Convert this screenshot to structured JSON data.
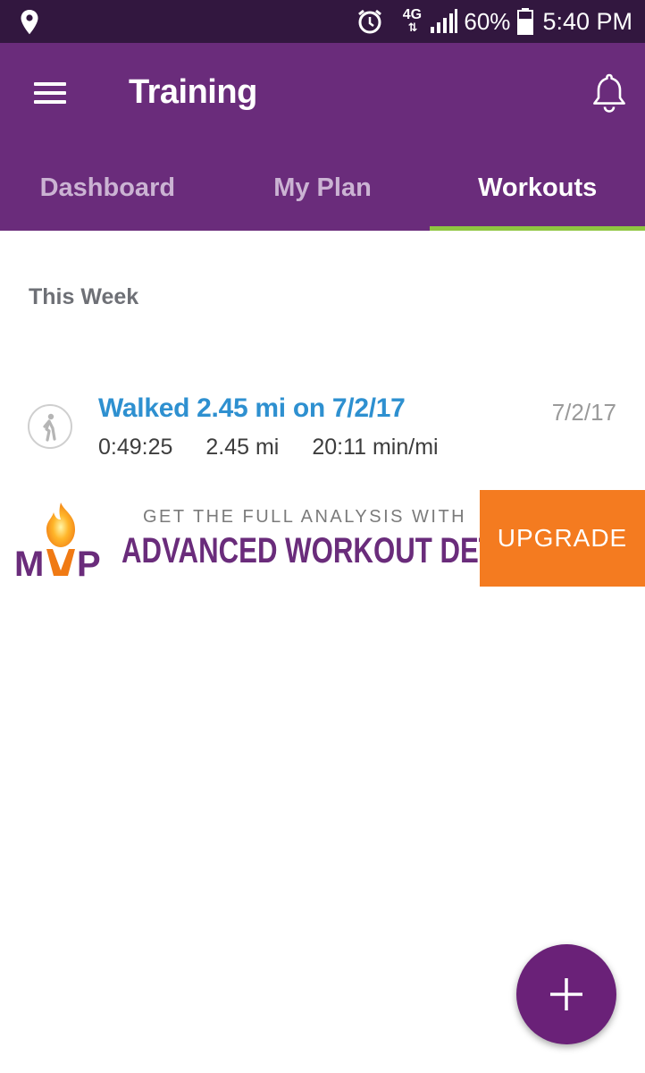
{
  "status_bar": {
    "network": "4G",
    "network_sub": "LTE",
    "battery_percent": "60%",
    "time": "5:40 PM",
    "icons": [
      "location-icon",
      "alarm-icon",
      "network-icon",
      "signal-icon",
      "battery-icon"
    ]
  },
  "app_bar": {
    "title": "Training",
    "menu_icon": "hamburger-menu-icon",
    "notification_icon": "bell-icon",
    "background_color": "#6a2c7b"
  },
  "tabs": [
    {
      "label": "Dashboard",
      "active": false
    },
    {
      "label": "My Plan",
      "active": false
    },
    {
      "label": "Workouts",
      "active": true
    }
  ],
  "section": {
    "title": "This Week"
  },
  "workouts": [
    {
      "title": "Walked 2.45 mi on 7/2/17",
      "date": "7/2/17",
      "duration": "0:49:25",
      "distance": "2.45 mi",
      "pace": "20:11 min/mi",
      "icon": "walking-icon"
    }
  ],
  "promo": {
    "logo_text": "MVP",
    "line1": "GET THE FULL ANALYSIS WITH",
    "line2": "ADVANCED WORKOUT DETAILS",
    "button_label": "UPGRADE",
    "button_color": "#f47b20"
  },
  "fab": {
    "icon": "plus-icon",
    "color": "#6a2178"
  }
}
